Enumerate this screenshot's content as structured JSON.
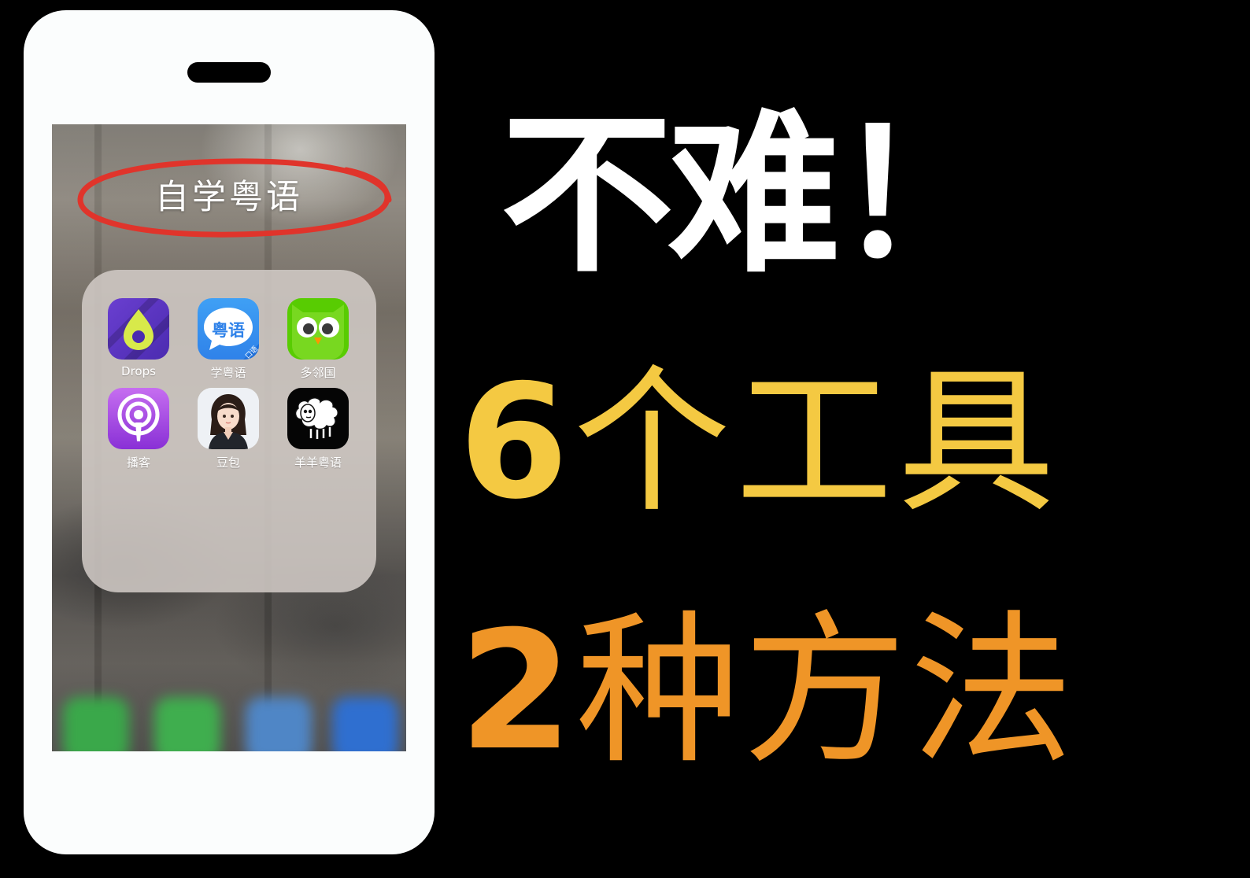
{
  "phone": {
    "folder_title": "自学粤语",
    "apps": [
      {
        "name": "Drops",
        "icon": "drops-icon"
      },
      {
        "name": "学粤语",
        "icon": "learn-cantonese-icon",
        "icon_text": "粤语",
        "corner_badge": "口语"
      },
      {
        "name": "多邻国",
        "icon": "duolingo-owl-icon"
      },
      {
        "name": "播客",
        "icon": "podcasts-icon"
      },
      {
        "name": "豆包",
        "icon": "doubao-avatar-icon"
      },
      {
        "name": "羊羊粤语",
        "icon": "sheep-icon"
      }
    ],
    "dock": [
      "phone-app-icon",
      "messages-app-icon",
      "safari-app-icon",
      "app-store-icon"
    ]
  },
  "headline": {
    "line1": "不难！",
    "line2_num": "6",
    "line2_text": "个工具",
    "line3_num": "2",
    "line3_text": "种方法"
  },
  "colors": {
    "background": "#000000",
    "phone_body": "#fbfdfd",
    "highlight_ring": "#e0342b",
    "line2": "#f4c942",
    "line3": "#ef9527"
  }
}
